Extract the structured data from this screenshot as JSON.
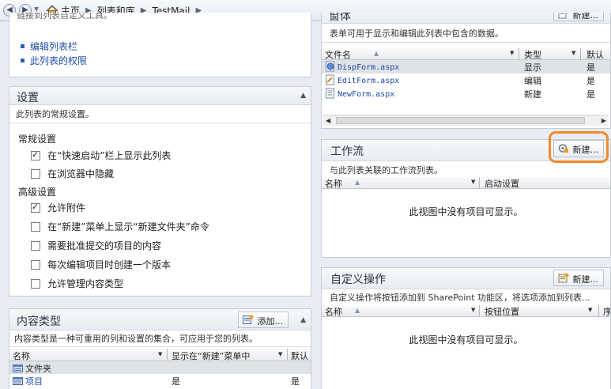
{
  "breadcrumb": {
    "items": [
      "主页",
      "列表和库",
      "TestMail"
    ]
  },
  "links_panel": {
    "partial_text": "链接到列表自定义工具。",
    "links": [
      "编辑列表栏",
      "此列表的权限"
    ]
  },
  "settings": {
    "title": "设置",
    "description": "此列表的常规设置。",
    "general_label": "常规设置",
    "general_options": [
      {
        "label": "在“快速启动”栏上显示此列表",
        "checked": true
      },
      {
        "label": "在浏览器中隐藏",
        "checked": false
      }
    ],
    "advanced_label": "高级设置",
    "advanced_options": [
      {
        "label": "允许附件",
        "checked": true
      },
      {
        "label": "在“新建”菜单上显示“新建文件夹”命令",
        "checked": false
      },
      {
        "label": "需要批准提交的项目的内容",
        "checked": false
      },
      {
        "label": "每次编辑项目时创建一个版本",
        "checked": false
      },
      {
        "label": "允许管理内容类型",
        "checked": false
      }
    ]
  },
  "content_types": {
    "title": "内容类型",
    "add_label": "添加...",
    "description": "内容类型是一种可重用的列和设置的集合，可应用于您的列表。",
    "columns": [
      "名称",
      "显示在“新建”菜单中",
      "默认"
    ],
    "rows": [
      {
        "name": "文件夹",
        "shown": "",
        "default": ""
      },
      {
        "name": "项目",
        "shown": "是",
        "default": "是"
      }
    ]
  },
  "forms": {
    "title": "窗体",
    "new_label": "新建...",
    "description": "表单可用于显示和编辑此列表中包含的数据。",
    "columns": [
      "文件名",
      "类型",
      "默认"
    ],
    "rows": [
      {
        "file": "DispForm.aspx",
        "type": "显示",
        "default": "是"
      },
      {
        "file": "EditForm.aspx",
        "type": "编辑",
        "default": "是"
      },
      {
        "file": "NewForm.aspx",
        "type": "新建",
        "default": "是"
      }
    ]
  },
  "workflow": {
    "title": "工作流",
    "new_label": "新建...",
    "description": "与此列表关联的工作流列表。",
    "columns": [
      "名称",
      "启动设置"
    ],
    "empty_text": "此视图中没有项目可显示。"
  },
  "custom_actions": {
    "title": "自定义操作",
    "new_label": "新建...",
    "description": "自定义操作将按钮添加到 SharePoint 功能区，将选项添加到列表...",
    "columns": [
      "名称",
      "按钮位置",
      "序"
    ],
    "empty_text": "此视图中没有项目可显示。"
  },
  "colors": {
    "highlight": "#f08a2a",
    "link": "#1d4aa5",
    "panel_header": "#e8ecf1"
  }
}
